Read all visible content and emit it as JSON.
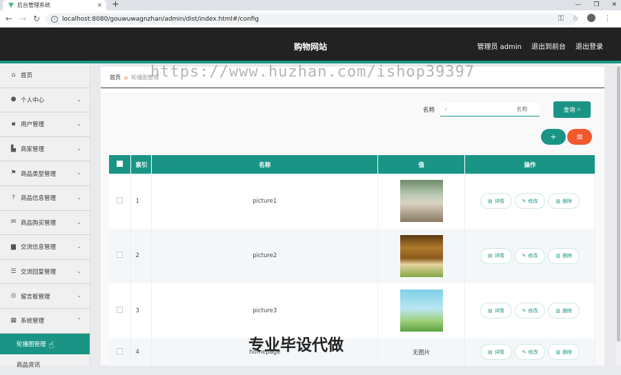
{
  "browser": {
    "tab_title": "后台管理系统",
    "tab_close": "×",
    "new_tab": "+",
    "url": "localhost:8080/gouwuwagnzhan/admin/dist/index.html#/config",
    "win_min": "—",
    "win_max": "❐",
    "win_close": "✕"
  },
  "header": {
    "site_title": "购物网站",
    "admin_label": "管理员 admin",
    "back_front": "退出到前台",
    "logout": "退出登录"
  },
  "sidebar": {
    "items": [
      {
        "label": "首页",
        "icon": "home-icon",
        "glyph": "⌂",
        "chevron": ""
      },
      {
        "label": "个人中心",
        "icon": "user-icon",
        "glyph": "●",
        "chevron": "⌄"
      },
      {
        "label": "用户管理",
        "icon": "users-icon",
        "glyph": "▪",
        "chevron": "⌄"
      },
      {
        "label": "商家管理",
        "icon": "shop-icon",
        "glyph": "▙",
        "chevron": "⌄"
      },
      {
        "label": "商品类型管理",
        "icon": "flag-icon",
        "glyph": "⚑",
        "chevron": "⌄"
      },
      {
        "label": "商品信息管理",
        "icon": "info-icon",
        "glyph": "?",
        "chevron": "⌄"
      },
      {
        "label": "商品购买管理",
        "icon": "mail-icon",
        "glyph": "✉",
        "chevron": "⌄"
      },
      {
        "label": "交流信息管理",
        "icon": "print-icon",
        "glyph": "▆",
        "chevron": "⌄"
      },
      {
        "label": "交流回复管理",
        "icon": "sliders-icon",
        "glyph": "☰",
        "chevron": "⌄"
      },
      {
        "label": "留言板管理",
        "icon": "board-icon",
        "glyph": "◎",
        "chevron": "⌄"
      },
      {
        "label": "系统管理",
        "icon": "grid-icon",
        "glyph": "▦",
        "chevron": "⌃"
      }
    ],
    "sub_items": [
      {
        "label": "轮播图管理",
        "active": true
      },
      {
        "label": "商品资讯",
        "active": false
      }
    ]
  },
  "breadcrumb": {
    "home": "首页",
    "current": "轮播图管理"
  },
  "search": {
    "label": "名称",
    "placeholder": "名称",
    "button": "查询"
  },
  "actions": {
    "add": "+",
    "delete": "🗑"
  },
  "table": {
    "headers": [
      "索引",
      "名称",
      "值",
      "操作"
    ],
    "rows": [
      {
        "index": "1",
        "name": "picture1",
        "value": "",
        "image": "picture1"
      },
      {
        "index": "2",
        "name": "picture2",
        "value": "",
        "image": "picture2"
      },
      {
        "index": "3",
        "name": "picture3",
        "value": "",
        "image": "picture3"
      },
      {
        "index": "4",
        "name": "homepage",
        "value": "无图片",
        "image": ""
      }
    ],
    "op_detail": "详情",
    "op_edit": "修改",
    "op_delete": "删除"
  },
  "overlays": {
    "watermark_url": "https://www.huzhan.com/ishop39397",
    "watermark_ad": "专业毕设代做"
  },
  "colors": {
    "accent": "#1a9585",
    "danger": "#f0582d",
    "header_bg": "#222222"
  }
}
